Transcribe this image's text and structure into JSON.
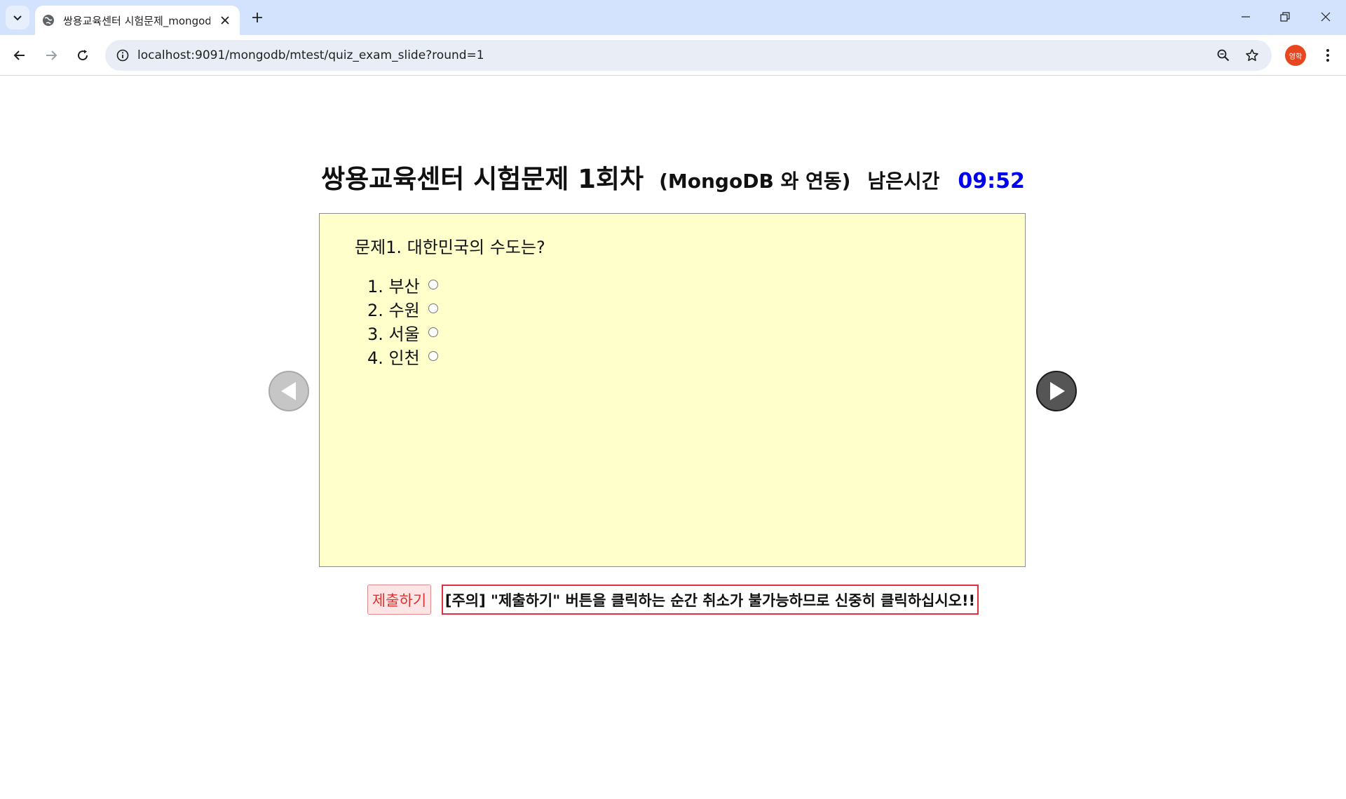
{
  "browser": {
    "tab_title": "쌍용교육센터 시험문제_mongodb",
    "url": "localhost:9091/mongodb/mtest/quiz_exam_slide?round=1",
    "profile_label": "영학"
  },
  "header": {
    "title": "쌍용교육센터 시험문제 1회차",
    "subtitle": "(MongoDB 와 연동)",
    "time_label": "남은시간",
    "time_remaining": "09:52"
  },
  "quiz": {
    "question": "문제1. 대한민국의 수도는?",
    "options": [
      {
        "label": "1. 부산"
      },
      {
        "label": "2. 수원"
      },
      {
        "label": "3. 서울"
      },
      {
        "label": "4. 인천"
      }
    ]
  },
  "footer": {
    "submit_label": "제출하기",
    "warning_text": "[주의] \"제출하기\" 버튼을 클릭하는 순간 취소가 불가능하므로 신중히 클릭하십시오!!"
  },
  "colors": {
    "quiz_background": "#ffffcc",
    "timer": "#0000ee",
    "warning_border": "#e0303f",
    "submit_text": "#e0312f"
  }
}
